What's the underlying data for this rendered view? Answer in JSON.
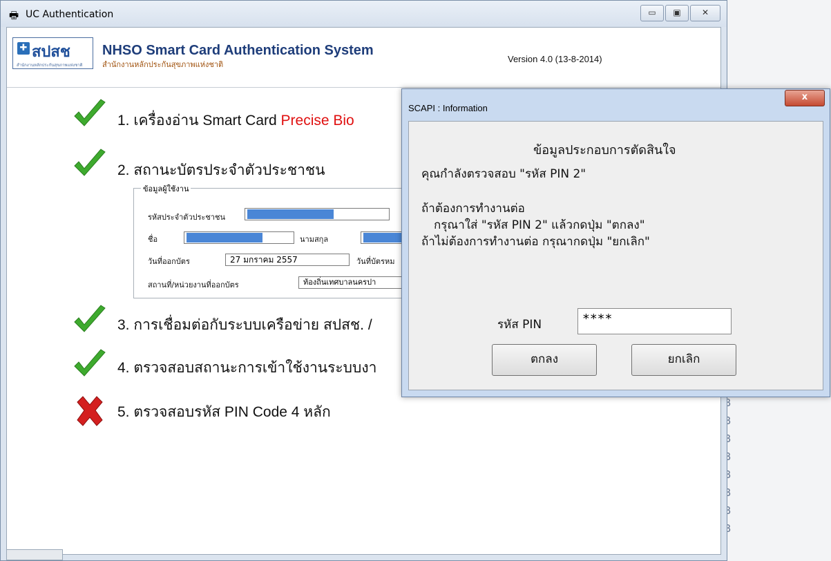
{
  "main": {
    "title": "UC Authentication",
    "header": {
      "logo_text": "สปสช",
      "logo_sub": "สำนักงานหลักประกันสุขภาพแห่งชาติ",
      "title": "NHSO Smart Card  Authentication System",
      "subtitle": "สำนักงานหลักประกันสุขภาพแห่งชาติ",
      "version": "Version 4.0 (13-8-2014)"
    },
    "steps": [
      {
        "label": "1. เครื่องอ่าน Smart Card",
        "highlight": "Precise Bio",
        "status": "ok"
      },
      {
        "label": "2. สถานะบัตรประจำตัวประชาชน",
        "status": "ok"
      },
      {
        "label": "3. การเชื่อมต่อกับระบบเครือข่าย สปสช. /",
        "status": "ok"
      },
      {
        "label": "4. ตรวจสอบสถานะการเข้าใช้งานระบบงา",
        "status": "ok"
      },
      {
        "label": "5. ตรวจสอบรหัส PIN Code 4 หลัก",
        "status": "fail"
      }
    ],
    "user_info": {
      "legend": "ข้อมูลผู้ใช้งาน",
      "id_label": "รหัสประจำตัวประชาชน",
      "name_label": "ชื่อ",
      "surname_label": "นามสกุล",
      "issue_date_label": "วันที่ออกบัตร",
      "issue_date_value": "27 มกราคม 2557",
      "expire_label": "วันที่บัตรหม",
      "issuer_label": "สถานที่/หน่วยงานที่ออกบัตร",
      "issuer_value": "ท้องถิ่นเทศบาลนครปา"
    }
  },
  "dialog": {
    "title": "SCAPI : Information",
    "close_label": "x",
    "heading": "ข้อมูลประกอบการตัดสินใจ",
    "line1": "คุณกำลังตรวจสอบ \"รหัส PIN 2\"",
    "line2": "ถ้าต้องการทำงานต่อ",
    "line3": "กรุณาใส่ \"รหัส PIN 2\" แล้วกดปุ่ม \"ตกลง\"",
    "line4": "ถ้าไม่ต้องการทำงานต่อ กรุณากดปุ่ม \"ยกเลิก\"",
    "pin_label": "รหัส PIN",
    "pin_value": "****",
    "ok_label": "ตกลง",
    "cancel_label": "ยกเลิก"
  },
  "window_buttons": {
    "minimize": "▭",
    "maximize": "▣",
    "close": "✕"
  }
}
